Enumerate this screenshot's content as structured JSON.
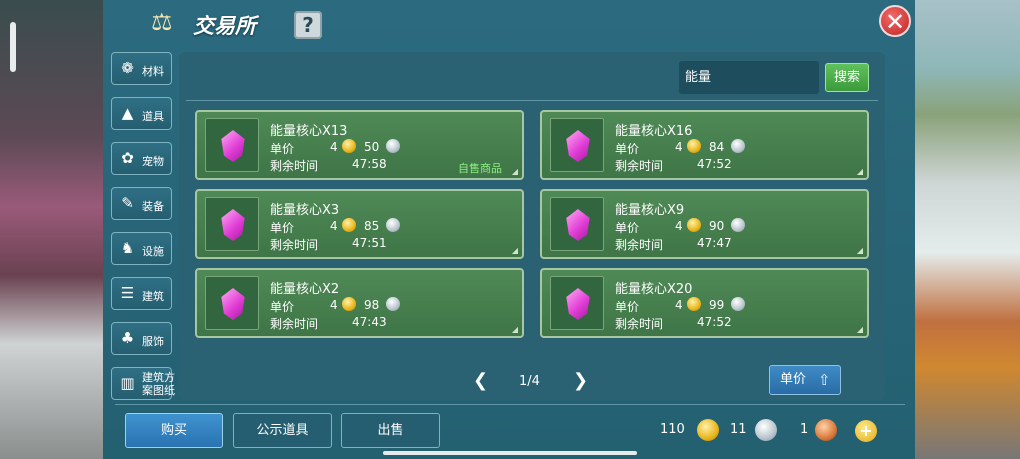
{
  "window": {
    "title": "交易所",
    "help_label": "?",
    "close_label": "✕"
  },
  "nav": {
    "items": [
      {
        "label": "材料",
        "icon": "materials-icon"
      },
      {
        "label": "道具",
        "icon": "props-icon"
      },
      {
        "label": "宠物",
        "icon": "pet-paw-icon"
      },
      {
        "label": "装备",
        "icon": "equipment-icon"
      },
      {
        "label": "设施",
        "icon": "facility-icon"
      },
      {
        "label": "建筑",
        "icon": "building-icon"
      },
      {
        "label": "服饰",
        "icon": "clothing-icon"
      },
      {
        "label": "建筑方案图纸",
        "icon": "blueprint-icon"
      }
    ]
  },
  "search": {
    "value": "能量",
    "button_label": "搜索"
  },
  "listings": [
    {
      "name": "能量核心X13",
      "price_label": "单价",
      "gold": "4",
      "silver": "50",
      "time_label": "剩余时间",
      "time": "47:58",
      "tag": "自售商品"
    },
    {
      "name": "能量核心X16",
      "price_label": "单价",
      "gold": "4",
      "silver": "84",
      "time_label": "剩余时间",
      "time": "47:52",
      "tag": ""
    },
    {
      "name": "能量核心X3",
      "price_label": "单价",
      "gold": "4",
      "silver": "85",
      "time_label": "剩余时间",
      "time": "47:51",
      "tag": ""
    },
    {
      "name": "能量核心X9",
      "price_label": "单价",
      "gold": "4",
      "silver": "90",
      "time_label": "剩余时间",
      "time": "47:47",
      "tag": ""
    },
    {
      "name": "能量核心X2",
      "price_label": "单价",
      "gold": "4",
      "silver": "98",
      "time_label": "剩余时间",
      "time": "47:43",
      "tag": ""
    },
    {
      "name": "能量核心X20",
      "price_label": "单价",
      "gold": "4",
      "silver": "99",
      "time_label": "剩余时间",
      "time": "47:52",
      "tag": ""
    }
  ],
  "pager": {
    "text": "1/4"
  },
  "sort": {
    "label": "单价"
  },
  "tabs": {
    "buy": "购买",
    "public": "公示道具",
    "sell": "出售"
  },
  "currency": {
    "gold": "110",
    "silver": "11",
    "copper": "1"
  },
  "colors": {
    "accent_green": "#3f7547",
    "self_sale_tag": "#8cf081",
    "active_tab": "#2a73b2",
    "window_bg": "#2c6a80"
  }
}
